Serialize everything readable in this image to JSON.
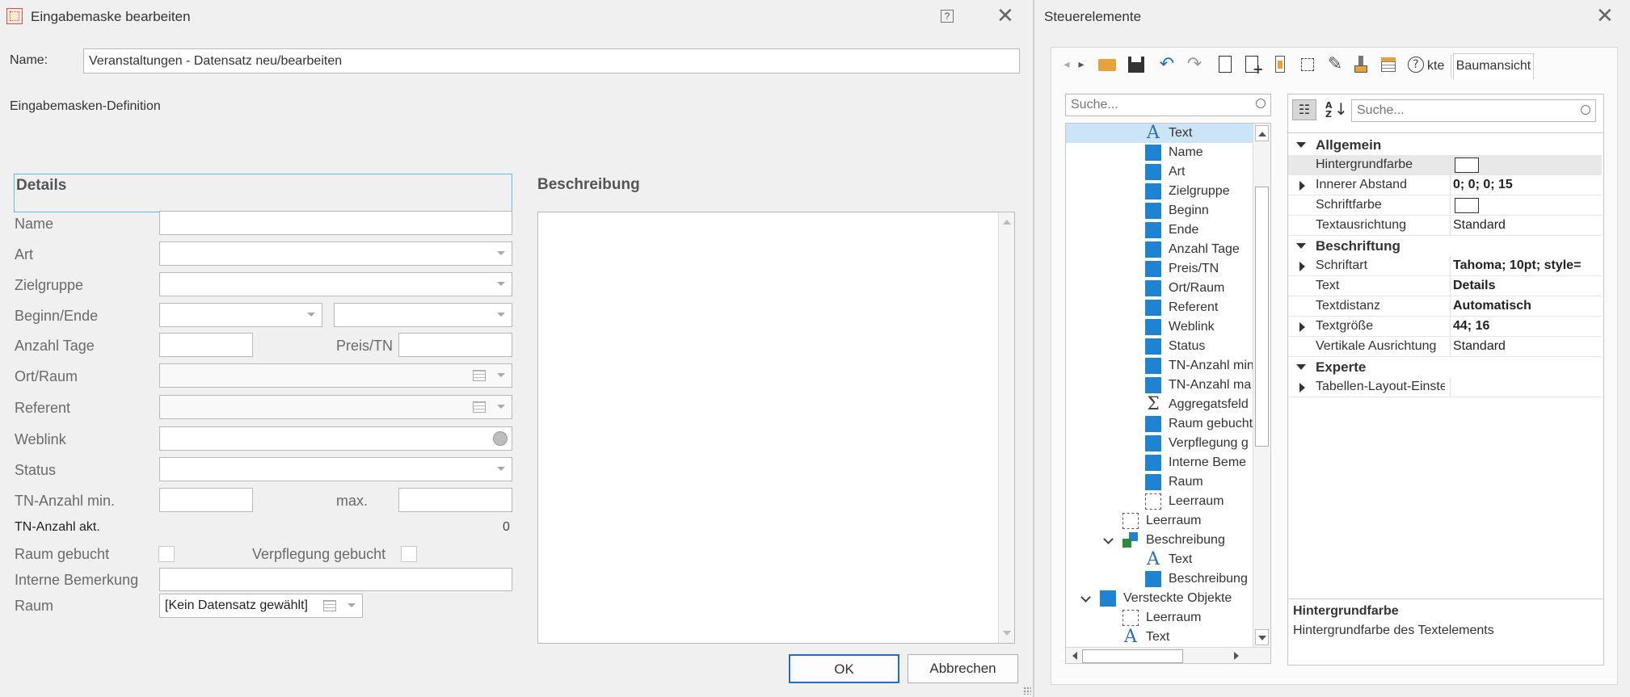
{
  "left_window": {
    "title": "Eingabemaske bearbeiten",
    "help_label": "?",
    "name_label": "Name:",
    "name_value": "Veranstaltungen - Datensatz neu/bearbeiten",
    "definition_label": "Eingabemasken-Definition",
    "details_header": "Details",
    "beschreibung_header": "Beschreibung",
    "fields": {
      "name": "Name",
      "art": "Art",
      "zielgruppe": "Zielgruppe",
      "beginn_ende": "Beginn/Ende",
      "anzahl_tage": "Anzahl Tage",
      "preis_tn": "Preis/TN",
      "ort_raum": "Ort/Raum",
      "referent": "Referent",
      "weblink": "Weblink",
      "status": "Status",
      "tn_min": "TN-Anzahl min.",
      "tn_max": "max.",
      "tn_akt": "TN-Anzahl akt.",
      "tn_akt_value": "0",
      "raum_gebucht": "Raum gebucht",
      "verpflegung_gebucht": "Verpflegung gebucht",
      "interne_bemerkung": "Interne Bemerkung",
      "raum": "Raum",
      "raum_value": "[Kein Datensatz gewählt]"
    },
    "ok_label": "OK",
    "cancel_label": "Abbrechen"
  },
  "right_window": {
    "title": "Steuerelemente",
    "tab_partial": "kte",
    "tab_active": "Baumansicht",
    "tree_search_placeholder": "Suche...",
    "prop_search_placeholder": "Suche...",
    "tree_items": [
      {
        "label": "Text",
        "icon": "text-A-icon",
        "level": 2,
        "selected": true
      },
      {
        "label": "Name",
        "icon": "field-icon",
        "level": 2
      },
      {
        "label": "Art",
        "icon": "field-icon",
        "level": 2
      },
      {
        "label": "Zielgruppe",
        "icon": "field-icon",
        "level": 2
      },
      {
        "label": "Beginn",
        "icon": "field-icon",
        "level": 2
      },
      {
        "label": "Ende",
        "icon": "field-icon",
        "level": 2
      },
      {
        "label": "Anzahl Tage",
        "icon": "field-icon",
        "level": 2
      },
      {
        "label": "Preis/TN",
        "icon": "field-icon",
        "level": 2
      },
      {
        "label": "Ort/Raum",
        "icon": "field-icon",
        "level": 2
      },
      {
        "label": "Referent",
        "icon": "field-icon",
        "level": 2
      },
      {
        "label": "Weblink",
        "icon": "field-icon",
        "level": 2
      },
      {
        "label": "Status",
        "icon": "field-icon",
        "level": 2
      },
      {
        "label": "TN-Anzahl min",
        "icon": "field-icon",
        "level": 2
      },
      {
        "label": "TN-Anzahl ma",
        "icon": "field-icon",
        "level": 2
      },
      {
        "label": "Aggregatsfeld",
        "icon": "sigma-icon",
        "level": 2
      },
      {
        "label": "Raum gebucht",
        "icon": "field-icon",
        "level": 2
      },
      {
        "label": "Verpflegung g",
        "icon": "field-icon",
        "level": 2
      },
      {
        "label": "Interne Beme",
        "icon": "field-icon",
        "level": 2
      },
      {
        "label": "Raum",
        "icon": "field-icon",
        "level": 2
      },
      {
        "label": "Leerraum",
        "icon": "spacer-icon",
        "level": 2
      },
      {
        "label": "Leerraum",
        "icon": "spacer-icon",
        "level": 1
      },
      {
        "label": "Beschreibung",
        "icon": "group-icon",
        "level": 1,
        "expanded": true
      },
      {
        "label": "Text",
        "icon": "text-A-icon",
        "level": 2
      },
      {
        "label": "Beschreibung",
        "icon": "field-icon",
        "level": 2
      },
      {
        "label": "Versteckte Objekte",
        "icon": "field-icon",
        "level": 0,
        "expanded": true
      },
      {
        "label": "Leerraum",
        "icon": "spacer-icon",
        "level": 1
      },
      {
        "label": "Text",
        "icon": "text-A-icon",
        "level": 1
      }
    ],
    "properties": {
      "cat_allgemein": "Allgemein",
      "hintergrundfarbe": "Hintergrundfarbe",
      "innerer_abstand": "Innerer Abstand",
      "innerer_abstand_val": "0; 0; 0; 15",
      "schriftfarbe": "Schriftfarbe",
      "textausrichtung": "Textausrichtung",
      "textausrichtung_val": "Standard",
      "cat_beschriftung": "Beschriftung",
      "schriftart": "Schriftart",
      "schriftart_val": "Tahoma; 10pt; style=",
      "text": "Text",
      "text_val": "Details",
      "textdistanz": "Textdistanz",
      "textdistanz_val": "Automatisch",
      "textgroesse": "Textgröße",
      "textgroesse_val": "44; 16",
      "vertikale": "Vertikale Ausrichtung",
      "vertikale_val": "Standard",
      "cat_experte": "Experte",
      "tabellen": "Tabellen-Layout-Einste"
    },
    "desc_title": "Hintergrundfarbe",
    "desc_text": "Hintergrundfarbe des Textelements"
  }
}
